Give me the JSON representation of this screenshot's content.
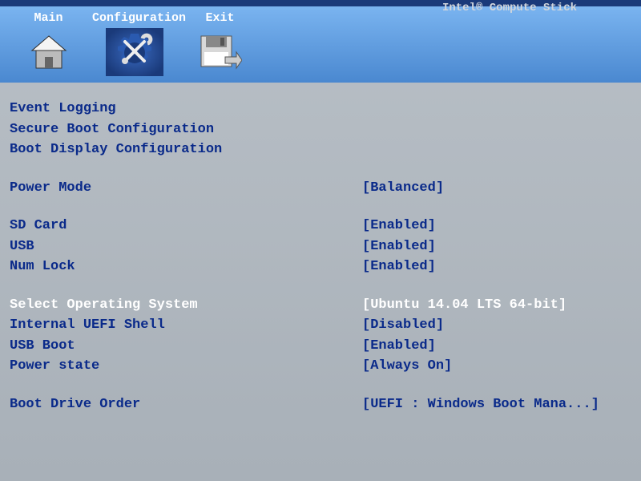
{
  "brand": "Intel® Compute Stick",
  "tabs": {
    "main": "Main",
    "configuration": "Configuration",
    "exit": "Exit"
  },
  "links": {
    "event_logging": "Event Logging",
    "secure_boot": "Secure Boot Configuration",
    "boot_display": "Boot Display Configuration"
  },
  "settings": {
    "power_mode": {
      "label": "Power Mode",
      "value": "Balanced"
    },
    "sd_card": {
      "label": "SD Card",
      "value": "Enabled"
    },
    "usb": {
      "label": "USB",
      "value": "Enabled"
    },
    "num_lock": {
      "label": "Num Lock",
      "value": "Enabled"
    },
    "select_os": {
      "label": "Select Operating System",
      "value": "Ubuntu 14.04 LTS 64-bit"
    },
    "uefi_shell": {
      "label": "Internal UEFI Shell",
      "value": "Disabled"
    },
    "usb_boot": {
      "label": "USB Boot",
      "value": "Enabled"
    },
    "power_state": {
      "label": "Power state",
      "value": "Always On"
    },
    "boot_drive": {
      "label": "Boot Drive Order",
      "value": "UEFI : Windows Boot Mana..."
    }
  }
}
